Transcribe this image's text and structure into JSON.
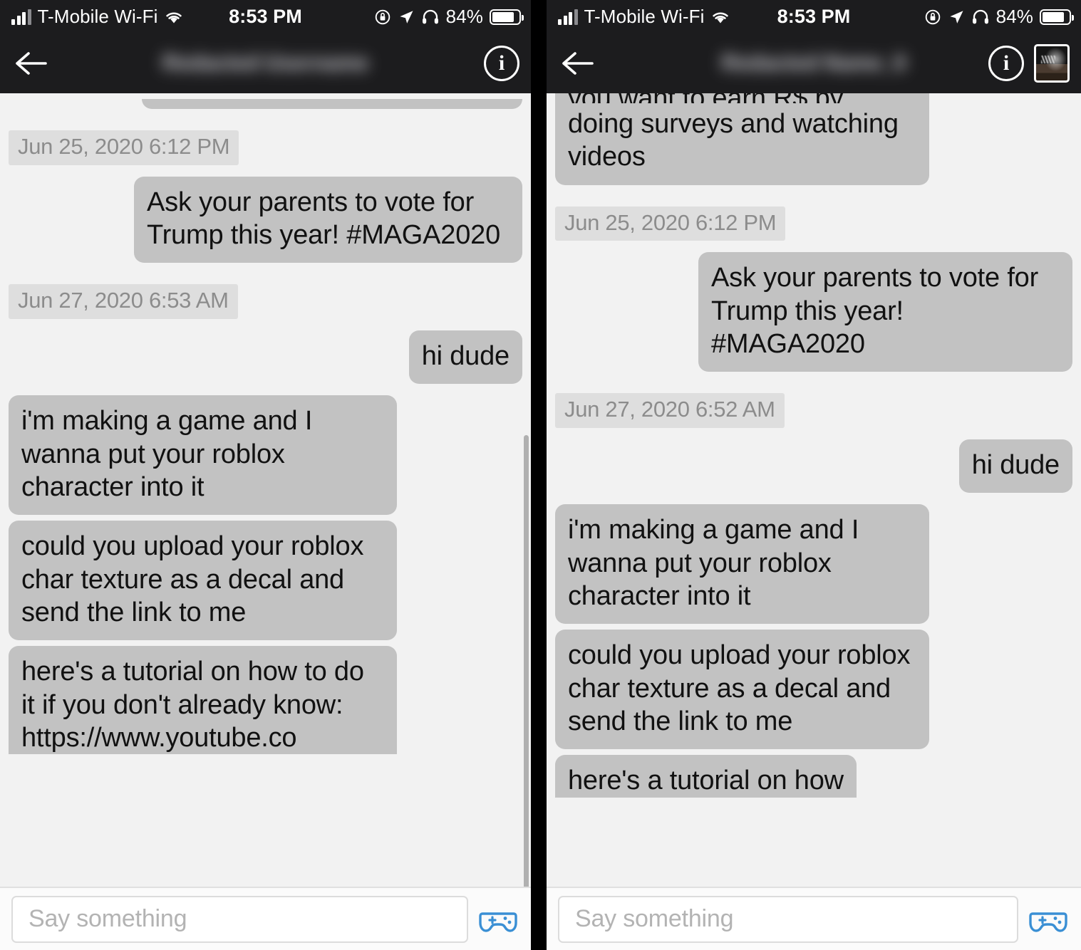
{
  "meta": {
    "accent_blue": "#3a8fd4",
    "bubble_gray": "#c2c2c2",
    "timestamp_bg": "#dedede",
    "chat_bg": "#f2f2f2",
    "navbar_bg": "#1c1c1e"
  },
  "status_bar": {
    "carrier": "T-Mobile Wi-Fi",
    "time": "8:53 PM",
    "battery_percent": "84%"
  },
  "panels": [
    {
      "id": "left",
      "nav": {
        "title_blurred": "Redacted Username",
        "info_label": "i",
        "has_thumbnail": false
      },
      "messages": [
        {
          "kind": "bubble-clipped-bottom",
          "side": "me",
          "text": ""
        },
        {
          "kind": "timestamp",
          "text": "Jun 25, 2020 6:12 PM"
        },
        {
          "kind": "bubble",
          "side": "me",
          "text": "Ask your parents to vote for Trump this year! #MAGA2020"
        },
        {
          "kind": "timestamp",
          "text": "Jun 27, 2020 6:53 AM"
        },
        {
          "kind": "bubble",
          "side": "me",
          "text": "hi dude"
        },
        {
          "kind": "bubble",
          "side": "them",
          "text": "i'm making a game and I wanna put your roblox character into it"
        },
        {
          "kind": "bubble",
          "side": "them",
          "text": "could you upload your roblox char texture as a decal and send the link to me"
        },
        {
          "kind": "bubble-cut",
          "side": "them",
          "text": "here's a tutorial on how to do it if you don't already know: https://www.youtube.co"
        }
      ],
      "input": {
        "placeholder": "Say something",
        "value": ""
      }
    },
    {
      "id": "right",
      "nav": {
        "title_blurred": "Redacted Name_0",
        "info_label": "i",
        "has_thumbnail": true
      },
      "messages": [
        {
          "kind": "bubble-clipped-top",
          "side": "them",
          "cut_line": "you want to earn R$ by",
          "text": "doing surveys and watching videos"
        },
        {
          "kind": "timestamp",
          "text": "Jun 25, 2020 6:12 PM"
        },
        {
          "kind": "bubble",
          "side": "me",
          "text": "Ask your parents to vote for Trump this year! #MAGA2020"
        },
        {
          "kind": "timestamp",
          "text": "Jun 27, 2020 6:52 AM"
        },
        {
          "kind": "bubble",
          "side": "me",
          "text": "hi dude"
        },
        {
          "kind": "bubble",
          "side": "them",
          "text": "i'm making a game and I wanna put your roblox character into it"
        },
        {
          "kind": "bubble",
          "side": "them",
          "text": "could you upload your roblox char texture as a decal and send the link to me"
        },
        {
          "kind": "bubble-clipped-bottom2",
          "side": "them",
          "text": "here's a tutorial on how"
        }
      ],
      "input": {
        "placeholder": "Say something",
        "value": ""
      }
    }
  ],
  "icons": {
    "signal": "signal-bars-icon",
    "wifi": "wifi-icon",
    "lock_rotation": "rotation-lock-icon",
    "location": "location-arrow-icon",
    "headphones": "headphones-icon",
    "battery": "battery-icon",
    "back": "back-arrow-icon",
    "info": "info-circle-icon",
    "thumbnail": "avatar-thumbnail-icon",
    "gamepad": "gamepad-icon"
  }
}
